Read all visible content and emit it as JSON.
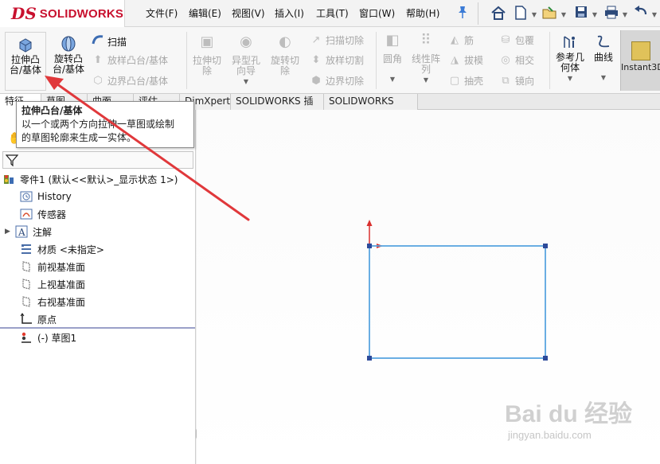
{
  "app": {
    "brand": "SOLIDWORKS",
    "logo_mark": "DS"
  },
  "menu": [
    "文件(F)",
    "编辑(E)",
    "视图(V)",
    "插入(I)",
    "工具(T)",
    "窗口(W)",
    "帮助(H)"
  ],
  "ribbon": {
    "extrude_boss": "拉伸凸\n台/基体",
    "revolve_boss": "旋转凸\n台/基体",
    "sweep": "扫描",
    "loft_boss": "放样凸台/基体",
    "boundary_boss": "边界凸台/基体",
    "extrude_cut": "拉伸切\n除",
    "hole_wizard": "异型孔\n向导",
    "revolve_cut": "旋转切\n除",
    "sweep_cut": "扫描切除",
    "loft_cut": "放样切割",
    "boundary_cut": "边界切除",
    "fillet": "圆角",
    "linear_pattern": "线性阵\n列",
    "rib": "筋",
    "draft": "拔模",
    "shell": "抽壳",
    "wrap": "包覆",
    "intersect": "相交",
    "mirror": "镜向",
    "ref_geometry": "参考几\n何体",
    "curves": "曲线",
    "instant3d": "Instant3D"
  },
  "tabs": [
    "特征",
    "草图",
    "曲面",
    "评估",
    "DimXpert",
    "SOLIDWORKS 插件",
    "SOLIDWORKS MBD"
  ],
  "tooltip": {
    "title": "拉伸凸台/基体",
    "line1": "以一个或两个方向拉伸一草图或绘制",
    "line2": "的草图轮廓来生成一实体。"
  },
  "tree": {
    "root": "零件1  (默认<<默认>_显示状态 1>)",
    "items": [
      "History",
      "传感器",
      "注解",
      "材质 <未指定>",
      "前视基准面",
      "上视基准面",
      "右视基准面",
      "原点",
      "(-) 草图1"
    ]
  },
  "watermark": {
    "text": "Bai du 经验",
    "url": "jingyan.baidu.com"
  },
  "colors": {
    "brand_red": "#c8102e",
    "sketch_blue": "#5aa6e0",
    "arrow_red": "#e0383b"
  }
}
